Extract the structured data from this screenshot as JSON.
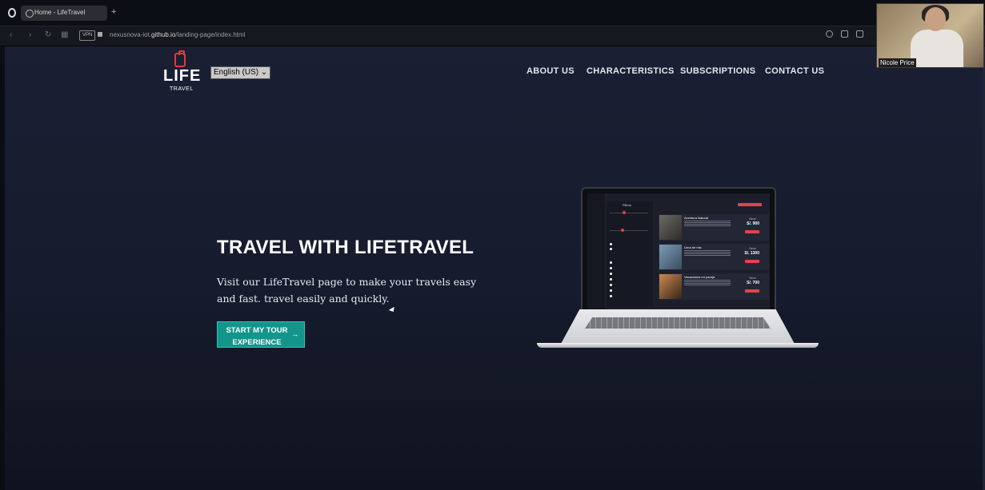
{
  "browser": {
    "tab_title": "Home - LifeTravel",
    "new_tab_symbol": "+",
    "url_prefix": "nexusnova-iot.",
    "url_domain": "github.io",
    "url_path": "/landing-page/index.html",
    "vpn_label": "VPN"
  },
  "header": {
    "logo_main": "LIFE",
    "logo_sub": "TRAVEL",
    "language": "English (US)",
    "nav": [
      "ABOUT US",
      "CHARACTERISTICS",
      "SUBSCRIPTIONS",
      "CONTACT US"
    ]
  },
  "hero": {
    "title": "TRAVEL WITH LIFETRAVEL",
    "subtitle": "Visit our LifeTravel page to make your travels easy and fast. travel easily and quickly.",
    "cta_label": "START MY TOUR EXPERIENCE",
    "cta_arrow": "→"
  },
  "laptop_screen": {
    "filter_title": "Filtros",
    "cards": [
      {
        "title": "Aventura Natural",
        "since": "Since",
        "price": "S/. 900"
      },
      {
        "title": "Lima de mis",
        "since": "Since",
        "price": "S/. 1300"
      },
      {
        "title": "Vacaciones en pareja",
        "since": "Since",
        "price": "S/. 700"
      }
    ]
  },
  "webcam": {
    "participant_name": "Nicole Price"
  },
  "colors": {
    "accent_teal": "#13958c",
    "brand_red": "#e03a3e",
    "page_bg": "#1a1f33"
  }
}
